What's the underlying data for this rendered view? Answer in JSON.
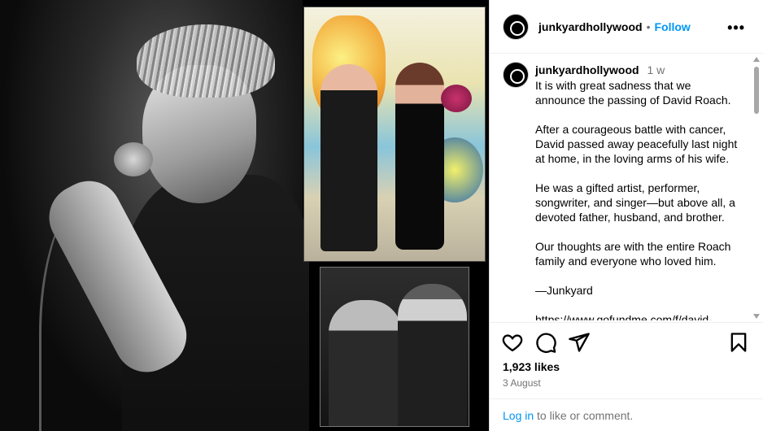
{
  "post": {
    "username": "junkyardhollywood",
    "follow_label": "Follow",
    "separator": "•",
    "more_icon": "more-options-icon",
    "time_ago": "1 w"
  },
  "caption": {
    "paragraphs": [
      "It is with great sadness that we announce the passing of David Roach.",
      "After a courageous battle with cancer, David passed away peacefully last night at home, in the loving arms of his wife.",
      "He was a gifted artist, performer, songwriter, and singer—but above all, a devoted father, husband, and brother.",
      "Our thoughts are with the entire Roach family and everyone who loved him.",
      "—Junkyard"
    ],
    "link": "https://www.gofundme.com/f/david-"
  },
  "actions": {
    "like_icon": "heart-icon",
    "comment_icon": "comment-icon",
    "share_icon": "share-icon",
    "save_icon": "bookmark-icon"
  },
  "stats": {
    "likes": "1,923 likes",
    "date": "3 August"
  },
  "login": {
    "link_label": "Log in",
    "rest": " to like or comment."
  }
}
